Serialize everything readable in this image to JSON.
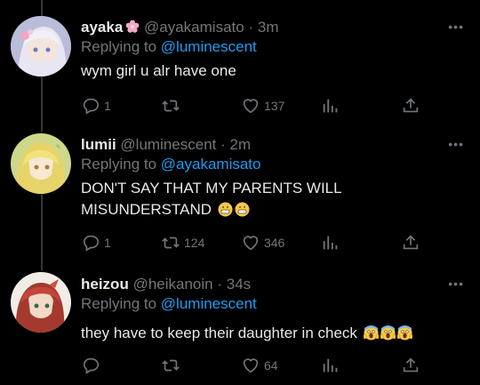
{
  "colors": {
    "background": "#000000",
    "text": "#e7e9ea",
    "muted": "#71767b",
    "link": "#1d9bf0"
  },
  "tweets": [
    {
      "display_name": "ayaka",
      "badge_icon": "cherry-blossom-icon",
      "handle": "@ayakamisato",
      "dot": "·",
      "time": "3m",
      "replying_prefix": "Replying to",
      "replying_to": "@luminescent",
      "text": "wym girl u alr have one",
      "emojis": [],
      "replies": "1",
      "retweets": "",
      "likes": "137",
      "more": "•••"
    },
    {
      "display_name": "lumii",
      "handle": "@luminescent",
      "dot": "·",
      "time": "2m",
      "replying_prefix": "Replying to",
      "replying_to": "@ayakamisato",
      "text": "DON'T SAY THAT MY PARENTS WILL MISUNDERSTAND",
      "emojis": [
        "grimacing-face-emoji",
        "grimacing-face-emoji"
      ],
      "replies": "1",
      "retweets": "124",
      "likes": "346",
      "more": "•••"
    },
    {
      "display_name": "heizou",
      "handle": "@heikanoin",
      "dot": "·",
      "time": "34s",
      "replying_prefix": "Replying to",
      "replying_to": "@luminescent",
      "text": "they have to keep their daughter in check",
      "emojis": [
        "screaming-face-emoji",
        "screaming-face-emoji",
        "screaming-face-emoji"
      ],
      "replies": "",
      "retweets": "",
      "likes": "64",
      "more": "•••"
    }
  ]
}
